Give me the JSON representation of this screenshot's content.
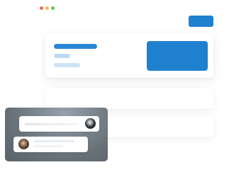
{
  "window": {
    "controls": [
      "close",
      "minimize",
      "zoom"
    ]
  },
  "toolbar": {
    "primary_button_label": ""
  },
  "main_card": {
    "title_placeholder": "",
    "subtitle_placeholder": "",
    "meta_placeholder": ""
  },
  "list_rows": [
    "",
    ""
  ],
  "comments": {
    "first": {
      "text": "",
      "avatar": "avatar-1"
    },
    "second": {
      "text": "",
      "avatar": "avatar-2"
    }
  },
  "colors": {
    "accent": "#1f80d0",
    "accent_light": "#bcd9f1",
    "overlay": "#697279"
  }
}
